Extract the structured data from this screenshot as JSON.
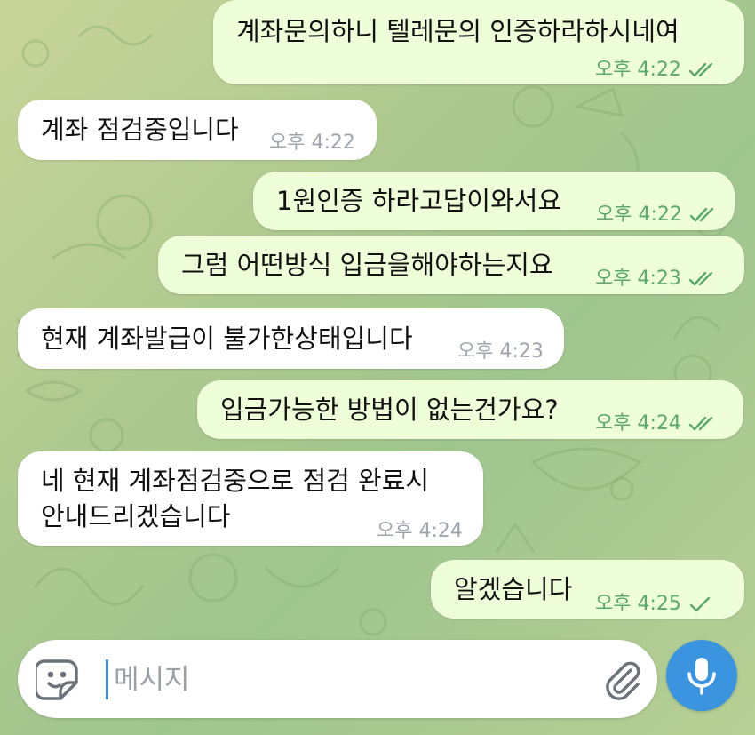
{
  "messages": [
    {
      "text": "계좌문의하니 텔레문의 인증하라하시네여",
      "time": "오후 4:22",
      "direction": "out",
      "status": "read"
    },
    {
      "text": "계좌 점검중입니다",
      "time": "오후 4:22",
      "direction": "in"
    },
    {
      "text": "1원인증 하라고답이와서요",
      "time": "오후 4:22",
      "direction": "out",
      "status": "read"
    },
    {
      "text": "그럼 어떤방식 입금을해야하는지요",
      "time": "오후 4:23",
      "direction": "out",
      "status": "read"
    },
    {
      "text": "현재 계좌발급이 불가한상태입니다",
      "time": "오후 4:23",
      "direction": "in"
    },
    {
      "text": "입금가능한 방법이 없는건가요?",
      "time": "오후 4:24",
      "direction": "out",
      "status": "read"
    },
    {
      "line1": "네 현재 계좌점검중으로 점검 완료시",
      "line2": "안내드리겠습니다",
      "time": "오후 4:24",
      "direction": "in"
    },
    {
      "text": "알겠습니다",
      "time": "오후 4:25",
      "direction": "out",
      "status": "sent"
    }
  ],
  "composer": {
    "placeholder": "메시지"
  },
  "colors": {
    "outgoing_bubble": "#eefed9",
    "incoming_bubble": "#ffffff",
    "check": "#5aa96a",
    "mic_button": "#3a94e0"
  },
  "icons": [
    "sticker-icon",
    "attach-icon",
    "mic-icon",
    "double-check-icon",
    "single-check-icon"
  ]
}
